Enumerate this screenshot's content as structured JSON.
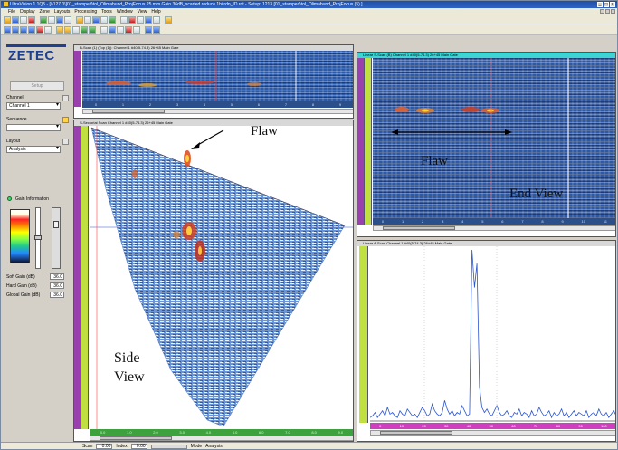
{
  "window": {
    "title": "UltraVision 1.1Q5 - [\\\\127.0\\]01_stamped\\tol_Olimabund_ProjFocus 25 mm Gain 36dB_scarfed reduce 1bi.rdn_ID.rdt - Setup: 1213 [01_stamped\\tol_Olimabund_ProjFocus (5) ]",
    "controls": [
      "_",
      "□",
      "×"
    ]
  },
  "menu": [
    "File",
    "Display",
    "Zone",
    "Layouts",
    "Processing",
    "Tools",
    "Window",
    "View",
    "Help"
  ],
  "left_panel": {
    "logo": "ZETEC",
    "setup_button": "Setup",
    "channel_label": "Channel",
    "channel_value": "Channel 1",
    "sequence_label": "Sequence",
    "sequence_value": "",
    "layout_label": "Layout",
    "layout_value": "Analysis",
    "gain_title": "Gain Information",
    "gain_fields": [
      {
        "label": "Soft Gain (dB)",
        "value": "36.0"
      },
      {
        "label": "Hard Gain (dB)",
        "value": "36.0"
      },
      {
        "label": "Global Gain (dB)",
        "value": "36.0"
      }
    ]
  },
  "panels": {
    "top_bscan": {
      "title": "B-Scan (1) (Top (1)): Channel 1 #40(5-74.3) 26+45 Main Gate"
    },
    "sector": {
      "title": "S-Sectorial Scan Channel 1 #40(5-74.3) 26+45 Main Gate"
    },
    "end_view": {
      "title": "Linear S-Scan (B) Channel 1 #40(5-74.3) 26+45 Main Gate"
    },
    "ascan": {
      "title": "Linear A-Scan Channel 1 #40(5-74.3) 26+45 Main Gate"
    }
  },
  "annotations": {
    "flaw_side": "Flaw",
    "flaw_end": "Flaw",
    "end_view": "End View",
    "side_view_line1": "Side",
    "side_view_line2": "View"
  },
  "ruler_ticks": {
    "sector_bottom": [
      "0.0",
      "1.0",
      "2.0",
      "3.0",
      "4.0",
      "5.0",
      "6.0",
      "7.0",
      "8.0",
      "9.0"
    ],
    "end_bottom": [
      "0",
      "1",
      "2",
      "3",
      "4",
      "5",
      "6",
      "7",
      "8",
      "9",
      "10",
      "11"
    ],
    "ascan_bottom": [
      "0",
      "10",
      "20",
      "30",
      "40",
      "50",
      "60",
      "70",
      "80",
      "90",
      "100"
    ]
  },
  "status": {
    "scan_label": "Scan",
    "scan_value": "0.00",
    "index_label": "Index",
    "index_value": "0.00",
    "mode_label": "Mode",
    "mode_value": "Analysis"
  },
  "ascan_trace": [
    2,
    3,
    5,
    2,
    4,
    6,
    3,
    8,
    4,
    5,
    3,
    2,
    6,
    4,
    3,
    7,
    5,
    3,
    4,
    2,
    5,
    8,
    6,
    3,
    4,
    10,
    6,
    4,
    3,
    5,
    12,
    7,
    4,
    6,
    3,
    5,
    4,
    9,
    6,
    3,
    4,
    100,
    78,
    92,
    20,
    8,
    5,
    7,
    4,
    3,
    6,
    9,
    5,
    3,
    4,
    6,
    3,
    2,
    5,
    4,
    7,
    3,
    5,
    4,
    2,
    6,
    3,
    4,
    8,
    5,
    3,
    4,
    6,
    2,
    5,
    3,
    4,
    7,
    3,
    5,
    2,
    4,
    6,
    3,
    5,
    4,
    3,
    6,
    2,
    4,
    5,
    3,
    7,
    4,
    3,
    5,
    2,
    4,
    6,
    3
  ],
  "colors": {
    "bscan_base": "#2c5aa8",
    "flaw_hot": "#e03020",
    "ascan_trace": "#2a55d0"
  }
}
